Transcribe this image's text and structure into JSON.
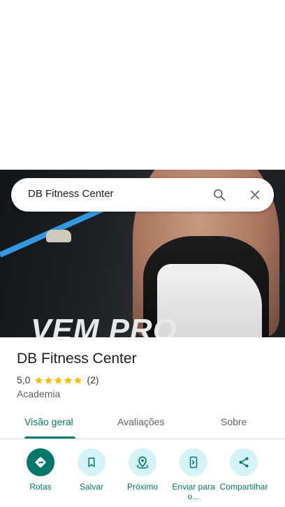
{
  "search": {
    "query": "DB Fitness Center"
  },
  "hero": {
    "banner_text": "VEM PRO"
  },
  "place": {
    "name": "DB Fitness Center",
    "rating": "5,0",
    "stars_filled": 5,
    "stars_total": 5,
    "review_count": "(2)",
    "category": "Academia"
  },
  "tabs": [
    {
      "label": "Visão geral",
      "active": true
    },
    {
      "label": "Avaliações",
      "active": false
    },
    {
      "label": "Sobre",
      "active": false
    }
  ],
  "actions": [
    {
      "label": "Rotas",
      "icon": "directions-icon"
    },
    {
      "label": "Salvar",
      "icon": "bookmark-icon"
    },
    {
      "label": "Próximo",
      "icon": "nearby-icon"
    },
    {
      "label": "Enviar para o...",
      "icon": "send-to-phone-icon"
    },
    {
      "label": "Compartilhar",
      "icon": "share-icon"
    }
  ],
  "colors": {
    "accent": "#00796b",
    "action_bg": "#d4f3f7",
    "star": "#fbbc04"
  }
}
